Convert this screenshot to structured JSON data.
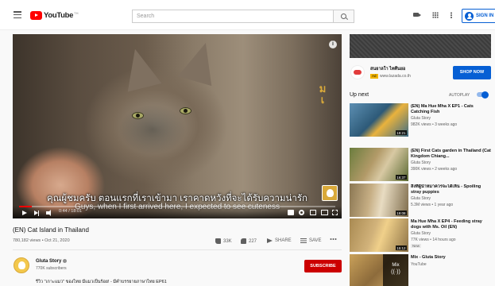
{
  "header": {
    "logo_text": "YouTube",
    "logo_tm": "TH",
    "search_placeholder": "Search",
    "signin_label": "SIGN IN"
  },
  "player": {
    "subtitle_thai": "คุณผู้ชมครับ ตอนแรกที่เราเข้ามา เราคาดหวังที่จะได้รับความน่ารัก",
    "subtitle_en": "Guys, when I first arrived here, I expected to see cuteness",
    "time": "0:44 / 18:01",
    "progress_fraction": 0.04
  },
  "video": {
    "title": "(EN) Cat Island in Thailand",
    "meta": "780,182 views • Oct 21, 2020",
    "likes": "33K",
    "dislikes": "227",
    "share_label": "SHARE",
    "save_label": "SAVE"
  },
  "channel": {
    "name": "Gluta Story",
    "subs": "770K subscribers",
    "subscribe_label": "SUBSCRIBE",
    "description": "รีวิว \"เกาะแมว\" ของไทย มีแมวเป็นร้อย! - มีคำบรรยายภาษาไทย EP61"
  },
  "ad": {
    "title": "สนยาลใา ไทศึนยอ",
    "badge": "Ad",
    "url": "www.lazada.co.th",
    "cta": "SHOP NOW"
  },
  "sidebar": {
    "upnext_label": "Up next",
    "autoplay_label": "AUTOPLAY",
    "autoplay_on": true,
    "items": [
      {
        "title": "(EN) Ma Hue Mha X EP1 - Cats Catching Fish",
        "channel": "Gluta Story",
        "meta": "982K views • 3 weeks ago",
        "duration": "19:21"
      },
      {
        "title": "(EN) First Cats garden in Thailand (Cat Kingdom Chiang...",
        "channel": "Gluta Story",
        "meta": "390K views • 2 weeks ago",
        "duration": "16:37"
      },
      {
        "title": "สิ่งที่ผู้นำหมาควรจะได้เห็น - Spoiling stray puppies",
        "channel": "Gluta Story",
        "meta": "5.3M views • 1 year ago",
        "duration": "19:08"
      },
      {
        "title": "Ma Hue Mha X EP4 - Feeding stray dogs with Ms. Oil (EN)",
        "channel": "Gluta Story",
        "meta": "77K views • 14 hours ago",
        "badge": "New",
        "duration": "15:12"
      },
      {
        "title": "Mix - Gluta Story",
        "channel": "YouTube",
        "mix_label": "Mix",
        "mix_icon": "((·))"
      }
    ]
  },
  "colors": {
    "brand_red": "#ff0000",
    "accent_blue": "#065fd4",
    "subscribe_red": "#cc0000"
  }
}
